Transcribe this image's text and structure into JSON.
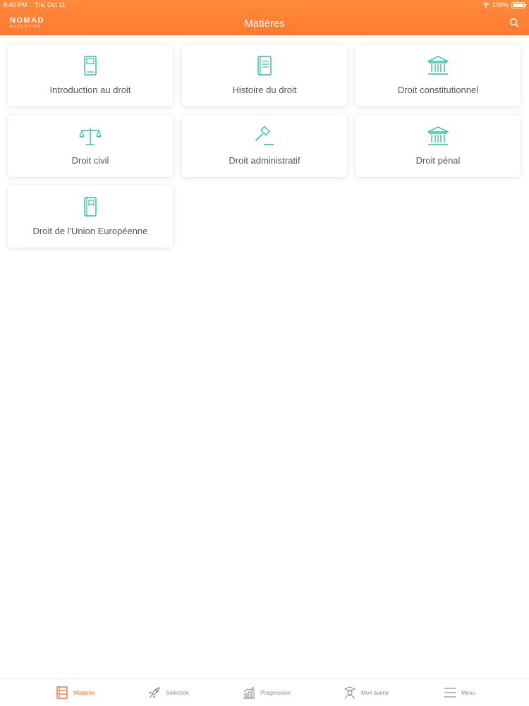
{
  "status_bar": {
    "time": "8:40 PM",
    "date": "Thu Oct 11",
    "battery": "100%"
  },
  "header": {
    "logo_main": "NOMAD",
    "logo_sub": "EDUCATION",
    "title": "Matières"
  },
  "subjects": [
    {
      "label": "Introduction au droit",
      "icon": "notebook-icon"
    },
    {
      "label": "Histoire du droit",
      "icon": "book-icon"
    },
    {
      "label": "Droit constitutionnel",
      "icon": "institution-icon"
    },
    {
      "label": "Droit civil",
      "icon": "scales-icon"
    },
    {
      "label": "Droit administratif",
      "icon": "gavel-icon"
    },
    {
      "label": "Droit pénal",
      "icon": "institution-icon"
    },
    {
      "label": "Droit de l'Union Européenne",
      "icon": "folder-book-icon"
    }
  ],
  "tabbar": {
    "items": [
      {
        "label": "Matières",
        "icon": "books-icon",
        "active": true
      },
      {
        "label": "Sélection",
        "icon": "rocket-icon",
        "active": false
      },
      {
        "label": "Progression",
        "icon": "chart-icon",
        "active": false
      },
      {
        "label": "Mon avenir",
        "icon": "graduate-icon",
        "active": false
      },
      {
        "label": "Menu",
        "icon": "hamburger-icon",
        "active": false
      }
    ]
  },
  "colors": {
    "accent": "#ff7a2f",
    "icon": "#2fbfa0",
    "active_tab": "#f26a2a"
  }
}
